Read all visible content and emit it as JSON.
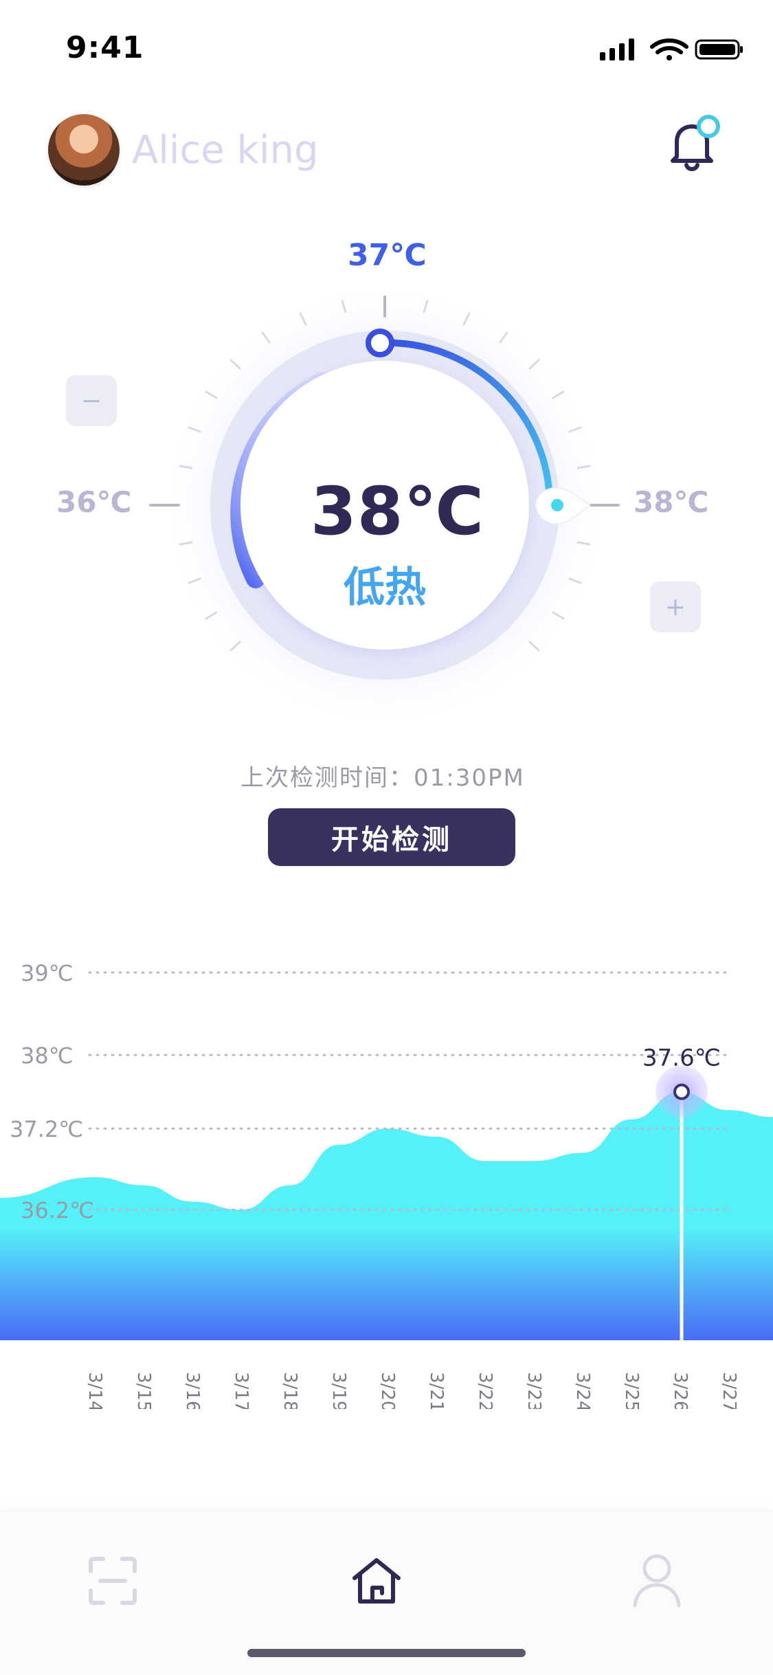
{
  "status_bar": {
    "time": "9:41"
  },
  "header": {
    "user_name": "Alice king"
  },
  "dial": {
    "label_top": "37℃",
    "label_left": "36℃",
    "label_right": "38℃",
    "current_temp": "38℃",
    "status": "低热",
    "minus_label": "−",
    "plus_label": "+"
  },
  "detect": {
    "last_time": "上次检测时间：01:30PM",
    "start_button": "开始检测"
  },
  "chart_data": {
    "type": "area",
    "y_labels": [
      "39℃",
      "38℃",
      "37.2℃",
      "36.2℃"
    ],
    "x": [
      "3/14",
      "3/15",
      "3/16",
      "3/17",
      "3/18",
      "3/19",
      "3/20",
      "3/21",
      "3/22",
      "3/23",
      "3/24",
      "3/25",
      "3/26",
      "3/27"
    ],
    "values": [
      36.6,
      36.5,
      36.3,
      36.2,
      36.5,
      37.0,
      37.2,
      37.1,
      36.8,
      36.8,
      36.9,
      37.3,
      37.6,
      37.4
    ],
    "highlight": {
      "x": "3/26",
      "value": "37.6℃"
    },
    "colors": {
      "top": "#55f0f8",
      "bottom": "#4a6cf7",
      "grid": "#b8b8c8",
      "marker": "#3b3470"
    },
    "grid": true
  },
  "icons": {
    "scan": "scan-icon",
    "home": "home-icon",
    "user": "user-icon",
    "bell": "bell-icon"
  }
}
